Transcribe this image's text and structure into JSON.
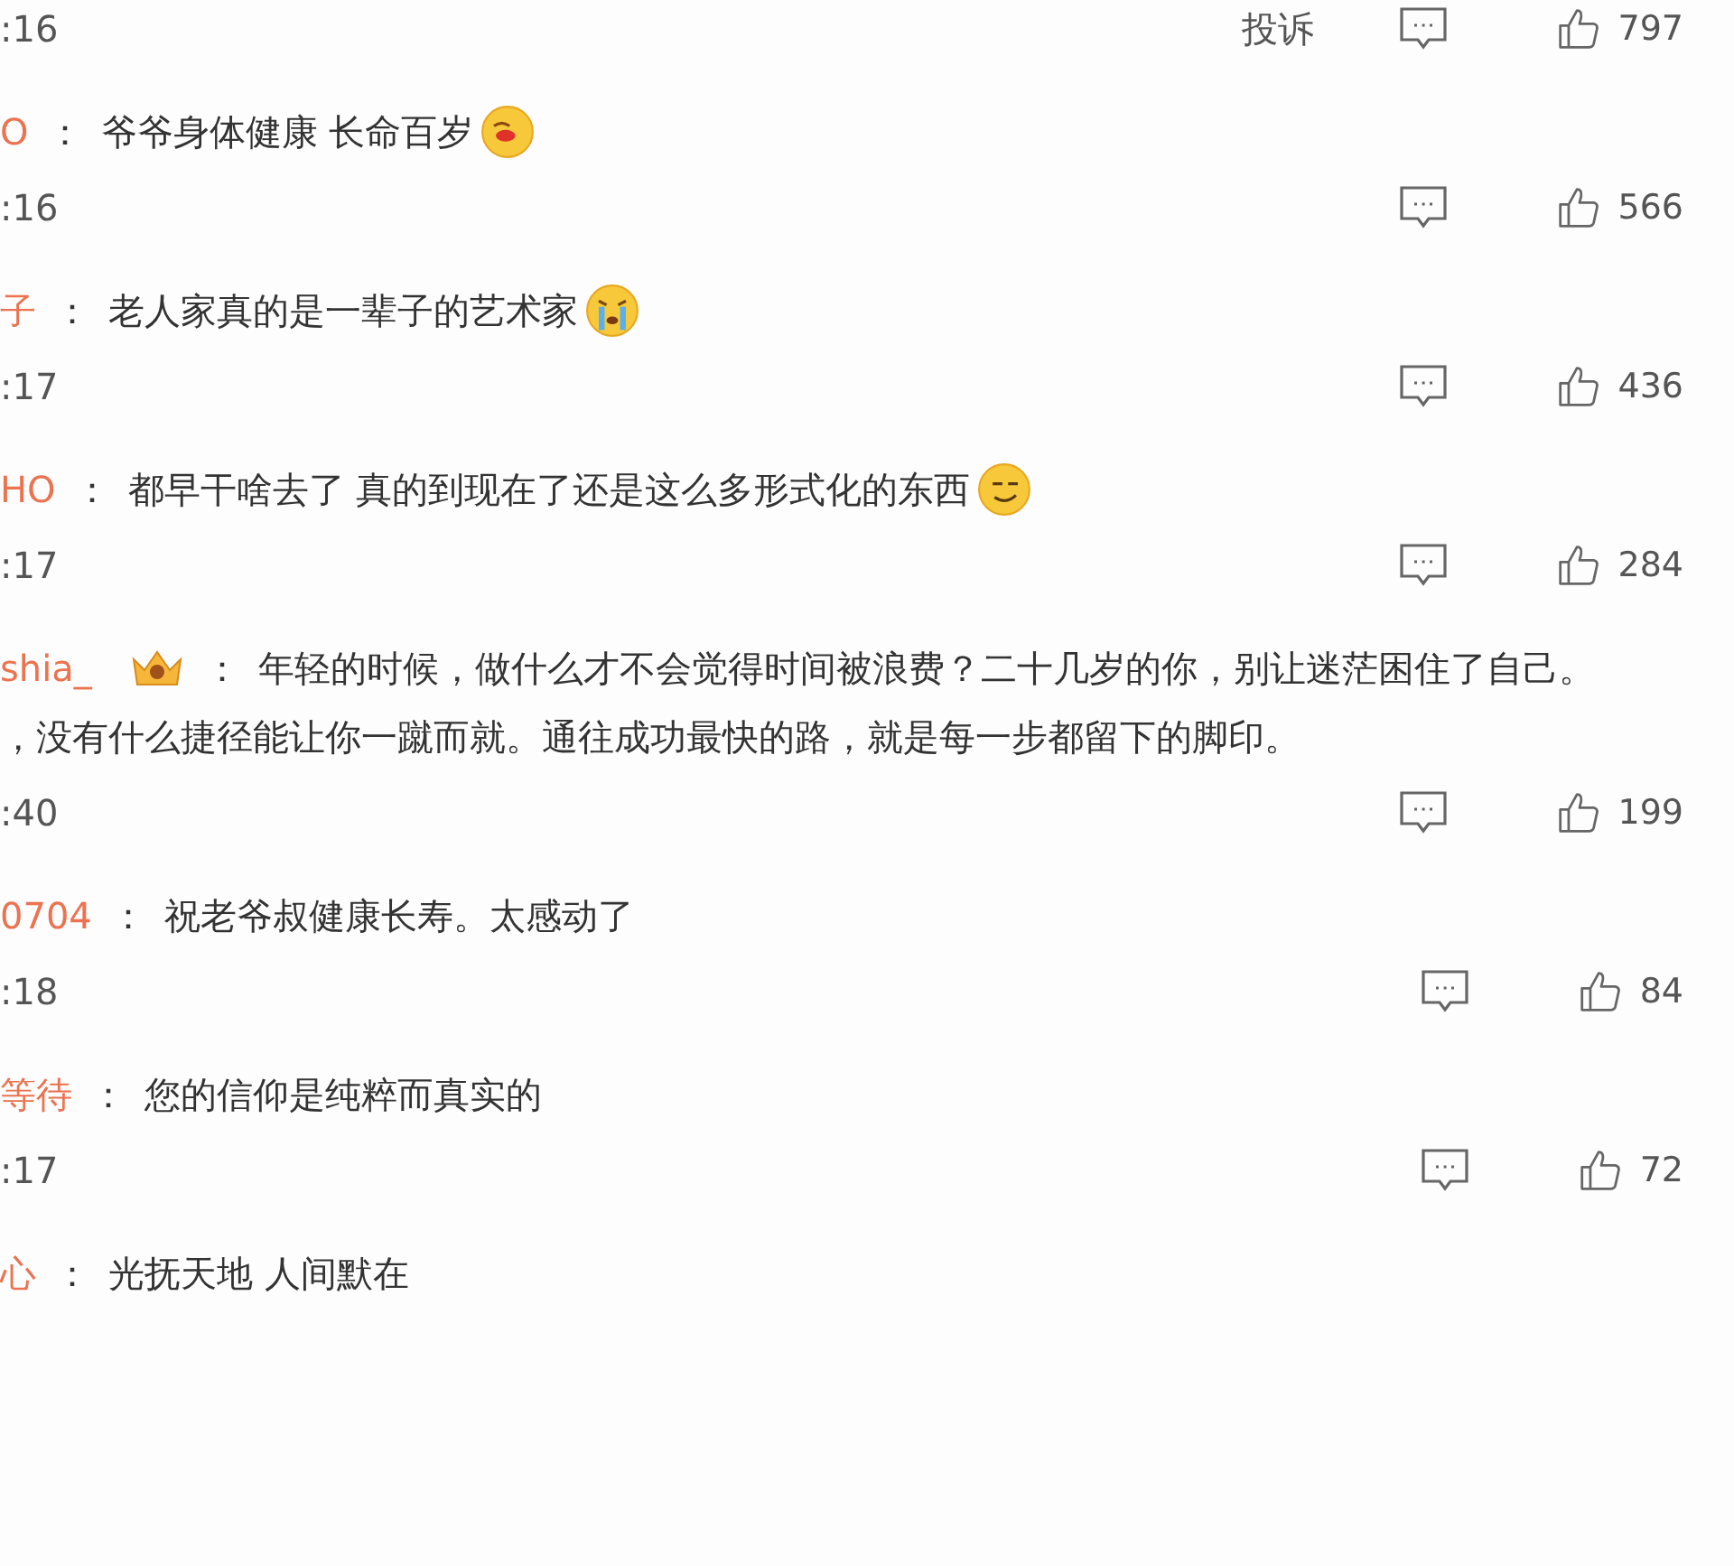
{
  "comments": [
    {
      "time": ":16",
      "report": "投诉",
      "likes": "797"
    },
    {
      "user": "O",
      "separator": "：",
      "text": "爷爷身体健康 长命百岁",
      "emoji": {
        "kind": "laugh"
      },
      "time": ":16",
      "likes": "566"
    },
    {
      "user": "子",
      "separator": "：",
      "text": "老人家真的是一辈子的艺术家",
      "emoji": {
        "kind": "cry"
      },
      "time": ":17",
      "likes": "436"
    },
    {
      "user": "HO",
      "separator": "：",
      "text": "都早干啥去了 真的到现在了还是这么多形式化的东西",
      "emoji": {
        "kind": "smirk"
      },
      "time": ":17",
      "likes": "284"
    },
    {
      "user": "shia_",
      "badge": true,
      "separator": "：",
      "text": "年轻的时候，做什么才不会觉得时间被浪费？二十几岁的你，别让迷茫困住了自己。",
      "text_2": "，没有什么捷径能让你一蹴而就。通往成功最快的路，就是每一步都留下的脚印。",
      "time": ":40",
      "likes": "199"
    },
    {
      "user": "0704",
      "separator": "：",
      "text": "祝老爷叔健康长寿。太感动了",
      "time": ":18",
      "likes": "84"
    },
    {
      "user": "等待",
      "separator": "：",
      "text": "您的信仰是纯粹而真实的",
      "time": ":17",
      "likes": "72"
    },
    {
      "user": "心",
      "separator": "：",
      "text": "光抚天地 人间默在"
    }
  ]
}
